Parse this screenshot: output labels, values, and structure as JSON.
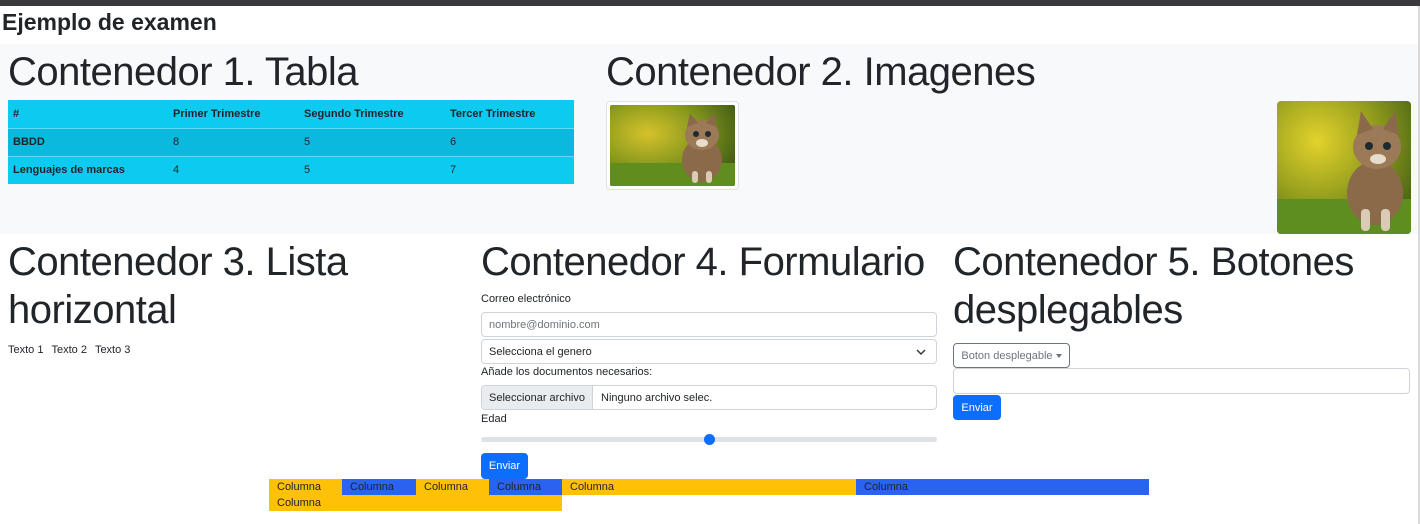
{
  "page_title": "Ejemplo de examen",
  "colors": {
    "table_accent": "#0dcaf0",
    "primary": "#0d6efd",
    "yellow": "#ffc107",
    "blue": "#2a62f2"
  },
  "container1": {
    "title": "Contenedor 1. Tabla",
    "headers": [
      "#",
      "Primer Trimestre",
      "Segundo Trimestre",
      "Tercer Trimestre"
    ],
    "rows": [
      [
        "BBDD",
        "8",
        "5",
        "6"
      ],
      [
        "Lenguajes de marcas",
        "4",
        "5",
        "7"
      ]
    ]
  },
  "container2": {
    "title": "Contenedor 2. Imagenes",
    "images": [
      "kitten-thumbnail",
      "kitten-large"
    ]
  },
  "container3": {
    "title": "Contenedor 3. Lista horizontal",
    "items": [
      "Texto 1",
      "Texto 2",
      "Texto 3"
    ]
  },
  "container4": {
    "title": "Contenedor 4. Formulario",
    "email_label": "Correo electrónico",
    "email_placeholder": "nombre@dominio.com",
    "gender_select": "Selecciona el genero",
    "docs_label": "Añade los documentos necesarios:",
    "file_button": "Seleccionar archivo",
    "file_status": "Ninguno archivo selec.",
    "age_label": "Edad",
    "age_value": 0.5,
    "submit": "Enviar"
  },
  "container5": {
    "title": "Contenedor 5. Botones desplegables",
    "dropdown": "Boton desplegable",
    "submit": "Enviar"
  },
  "columns": [
    "Columna",
    "Columna",
    "Columna",
    "Columna",
    "Columna",
    "Columna",
    "Columna"
  ]
}
